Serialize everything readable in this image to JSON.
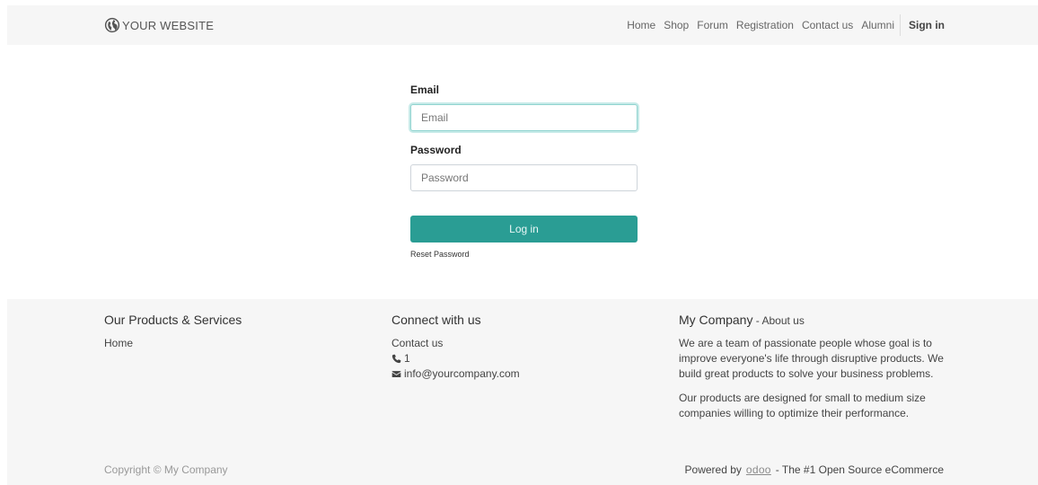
{
  "header": {
    "logo_text": "YOUR WEBSITE",
    "logo_icon": "globe-icon",
    "nav": [
      {
        "label": "Home"
      },
      {
        "label": "Shop"
      },
      {
        "label": "Forum"
      },
      {
        "label": "Registration"
      },
      {
        "label": "Contact us"
      },
      {
        "label": "Alumni"
      }
    ],
    "sign_in": "Sign in"
  },
  "login": {
    "email_label": "Email",
    "email_placeholder": "Email",
    "email_value": "",
    "password_label": "Password",
    "password_placeholder": "Password",
    "password_value": "",
    "login_button": "Log in",
    "reset_link": "Reset Password",
    "accent_color": "#2a9d94"
  },
  "footer": {
    "products": {
      "title": "Our Products & Services",
      "links": [
        "Home"
      ]
    },
    "connect": {
      "title": "Connect with us",
      "contact_link": "Contact us",
      "phone": "1",
      "phone_icon": "phone-icon",
      "email": "info@yourcompany.com",
      "email_icon": "envelope-icon"
    },
    "company": {
      "title": "My Company",
      "about": " - About us",
      "paragraph1": "We are a team of passionate people whose goal is to improve everyone's life through disruptive products. We build great products to solve your business problems.",
      "paragraph2": "Our products are designed for small to medium size companies willing to optimize their performance."
    },
    "copyright": "Copyright © My Company",
    "powered_prefix": "Powered by",
    "powered_brand": "odoo",
    "powered_suffix": "- The #1 Open Source eCommerce"
  }
}
